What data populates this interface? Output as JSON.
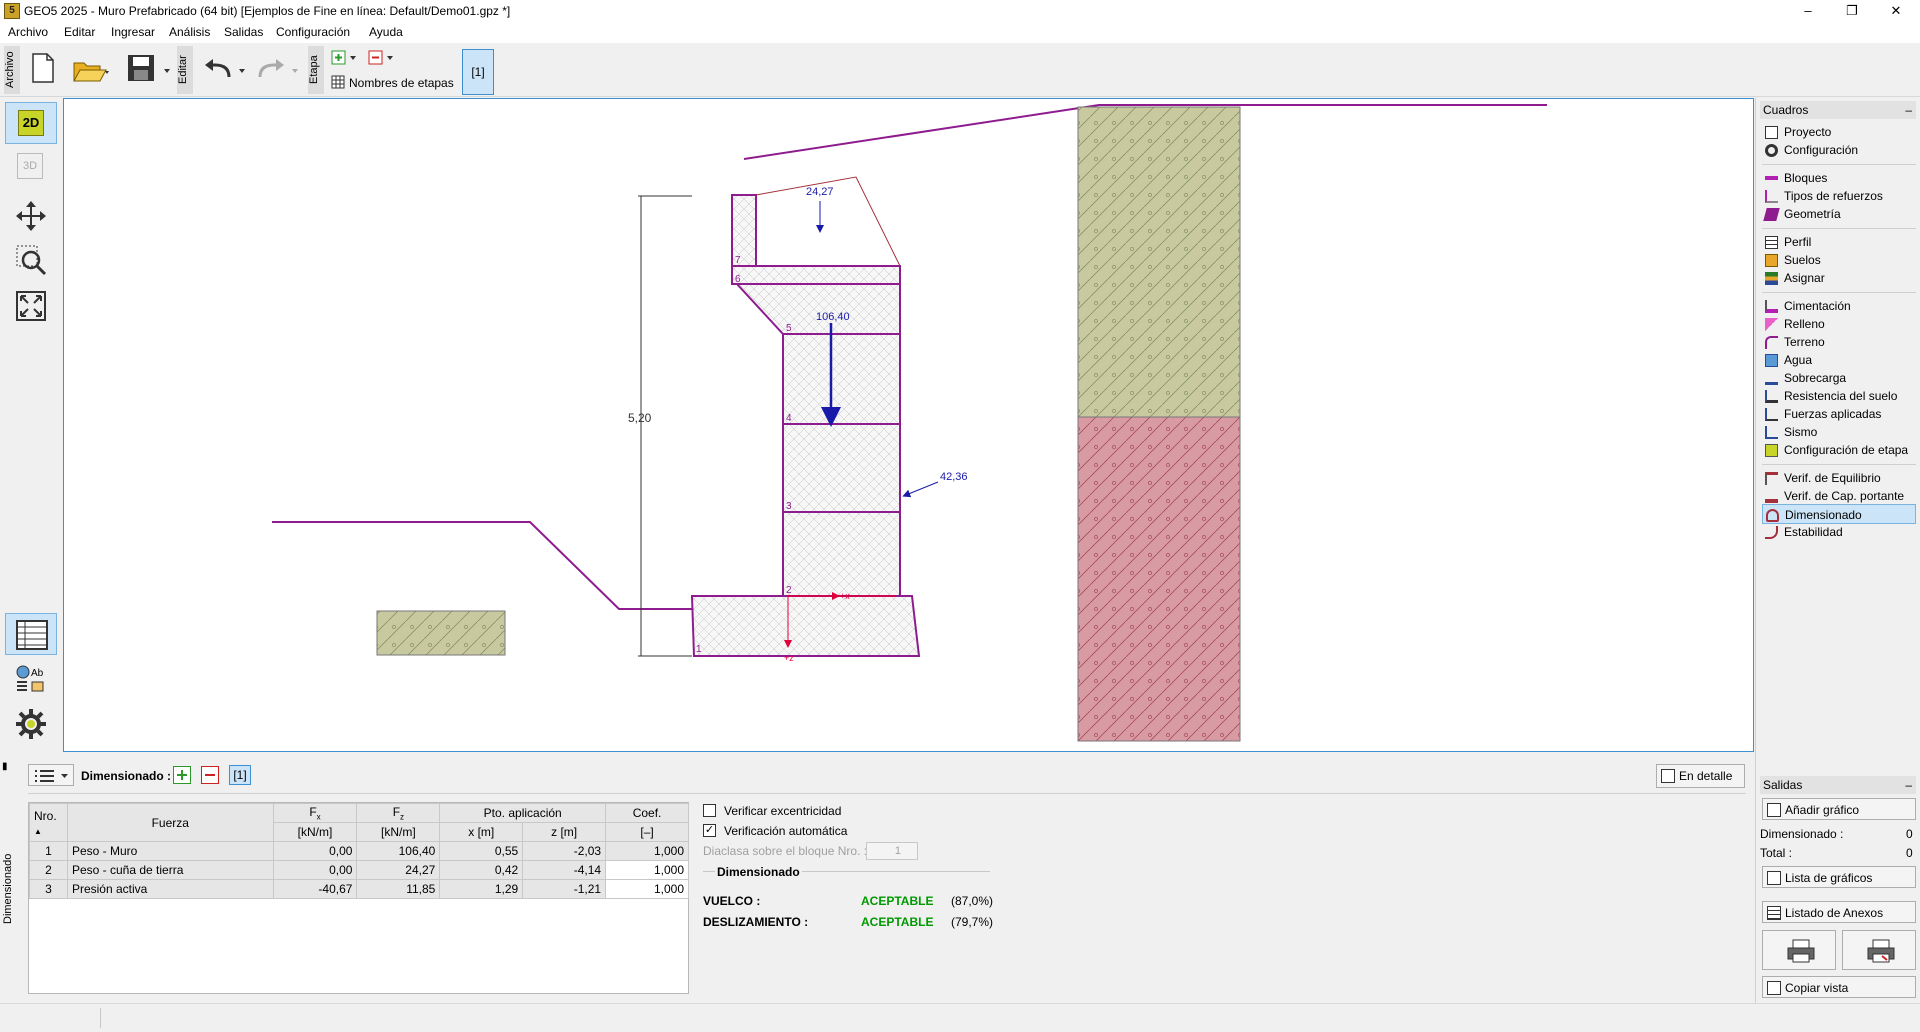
{
  "window": {
    "title": "GEO5 2025 - Muro Prefabricado (64 bit) [Ejemplos de Fine en línea: Default/Demo01.gpz *]",
    "app_icon_text": "5"
  },
  "menu": [
    "Archivo",
    "Editar",
    "Ingresar",
    "Análisis",
    "Salidas",
    "Configuración",
    "Ayuda"
  ],
  "toolbar": {
    "group_archivo": "Archivo",
    "group_editar": "Editar",
    "group_etapa": "Etapa",
    "stage_names_label": "Nombres de etapas",
    "stage_button": "[1]"
  },
  "left_tools": {
    "mode_2d": "2D",
    "mode_3d": "3D"
  },
  "drawing": {
    "dimension_label": "5,20",
    "force_top": "24,27",
    "force_weight": "106,40",
    "force_active": "42,36",
    "block_numbers": [
      "1",
      "2",
      "3",
      "4",
      "5",
      "6",
      "7"
    ],
    "axis_x": "+x",
    "axis_z": "+z",
    "colors": {
      "wall_outline": "#8e1c8e",
      "soil_upper": "#c9c9a0",
      "soil_lower": "#d89aa3",
      "force_arrow": "#1a1aa8",
      "axis": "#e0003c"
    }
  },
  "right_panel": {
    "cuadros_title": "Cuadros",
    "items_group1": [
      "Proyecto",
      "Configuración"
    ],
    "items_group2": [
      "Bloques",
      "Tipos de refuerzos",
      "Geometría"
    ],
    "items_group3": [
      "Perfil",
      "Suelos",
      "Asignar"
    ],
    "items_group4": [
      "Cimentación",
      "Relleno",
      "Terreno",
      "Agua",
      "Sobrecarga",
      "Resistencia del suelo",
      "Fuerzas aplicadas",
      "Sismo",
      "Configuración de etapa"
    ],
    "items_group5": [
      "Verif. de Equilibrio",
      "Verif. de Cap. portante",
      "Dimensionado",
      "Estabilidad"
    ],
    "selected": "Dimensionado",
    "salidas_title": "Salidas",
    "add_graphic": "Añadir gráfico",
    "dimensionado_label": "Dimensionado :",
    "dimensionado_count": "0",
    "total_label": "Total :",
    "total_count": "0",
    "list_graphics": "Lista de gráficos",
    "list_annex": "Listado de Anexos",
    "copy_view": "Copiar vista"
  },
  "bottom_panel": {
    "side_label": "Dimensionado",
    "header_label": "Dimensionado :",
    "stage_tag": "[1]",
    "detail_button": "En detalle",
    "table": {
      "headers": {
        "nro": "Nro.",
        "fuerza": "Fuerza",
        "fx": "F",
        "fx_sub": "x",
        "fx_unit": "[kN/m]",
        "fz": "F",
        "fz_sub": "z",
        "fz_unit": "[kN/m]",
        "pto": "Pto. aplicación",
        "x": "x [m]",
        "z": "z [m]",
        "coef": "Coef.",
        "coef_unit": "[–]"
      },
      "rows": [
        {
          "nro": "1",
          "fuerza": "Peso - Muro",
          "fx": "0,00",
          "fz": "106,40",
          "x": "0,55",
          "z": "-2,03",
          "coef": "1,000"
        },
        {
          "nro": "2",
          "fuerza": "Peso - cuña de tierra",
          "fx": "0,00",
          "fz": "24,27",
          "x": "0,42",
          "z": "-4,14",
          "coef": "1,000"
        },
        {
          "nro": "3",
          "fuerza": "Presión activa",
          "fx": "-40,67",
          "fz": "11,85",
          "x": "1,29",
          "z": "-1,21",
          "coef": "1,000"
        }
      ]
    },
    "check_eccentricity": "Verificar excentricidad",
    "check_auto": "Verificación automática",
    "joint_label": "Diaclasa sobre el bloque Nro. :",
    "joint_value": "1",
    "result_title": "Dimensionado",
    "results": [
      {
        "label": "VUELCO :",
        "status": "ACEPTABLE",
        "pct": "(87,0%)"
      },
      {
        "label": "DESLIZAMIENTO :",
        "status": "ACEPTABLE",
        "pct": "(79,7%)"
      }
    ],
    "accept_color": "#009900"
  }
}
